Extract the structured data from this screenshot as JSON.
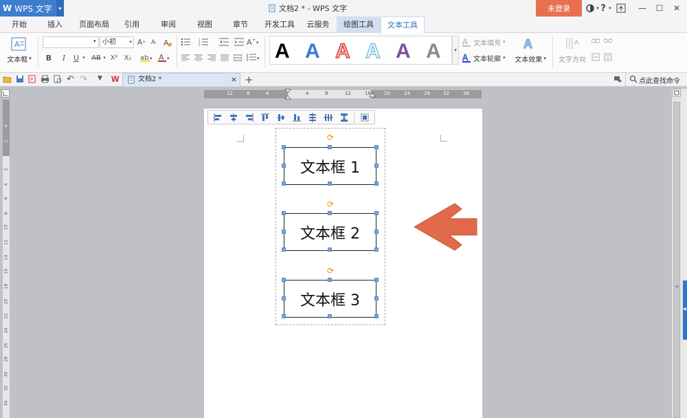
{
  "app": {
    "logo_text": "W",
    "name": "WPS 文字",
    "dropdown": "▾",
    "window_title": "文档2 * - WPS 文字",
    "login_label": "未登录",
    "help_label": "?",
    "min_label": "—",
    "max_label": "☐",
    "close_label": "✕"
  },
  "menu_tabs": [
    {
      "label": "开始"
    },
    {
      "label": "插入"
    },
    {
      "label": "页面布局"
    },
    {
      "label": "引用"
    },
    {
      "label": "审阅"
    },
    {
      "label": "视图"
    },
    {
      "label": "章节"
    },
    {
      "label": "开发工具"
    },
    {
      "label": "云服务"
    },
    {
      "label": "绘图工具"
    },
    {
      "label": "文本工具"
    }
  ],
  "ribbon": {
    "textbox_label": "文本框",
    "font_name_value": "",
    "font_size_value": "小初",
    "bold": "B",
    "italic": "I",
    "underline": "U",
    "strike": "AB",
    "superscript": "X²",
    "subscript": "X₂",
    "style_letter": "A",
    "text_fill_label": "文本填充",
    "text_outline_label": "文本轮廓",
    "text_effect_label": "文本效果",
    "text_direction_label": "文字方向"
  },
  "doc_tab": {
    "label": "文档2 *",
    "close": "×",
    "add": "+"
  },
  "find_command": "点此查找命令",
  "hruler": [
    "12",
    "8",
    "4",
    "4",
    "8",
    "12",
    "16",
    "20",
    "24",
    "28",
    "32",
    "36"
  ],
  "vruler": [
    "4",
    "2",
    "2",
    "4",
    "6",
    "8",
    "10",
    "12",
    "14",
    "16",
    "18",
    "20",
    "22",
    "24",
    "26",
    "28",
    "30",
    "32",
    "34"
  ],
  "textboxes": [
    {
      "text": "文本框 1"
    },
    {
      "text": "文本框 2"
    },
    {
      "text": "文本框 3"
    }
  ],
  "colors": {
    "app_blue": "#3c7dcd",
    "login_orange": "#e8704f",
    "arrow": "#e06a4a",
    "active_tab": "#2e6fc2"
  }
}
